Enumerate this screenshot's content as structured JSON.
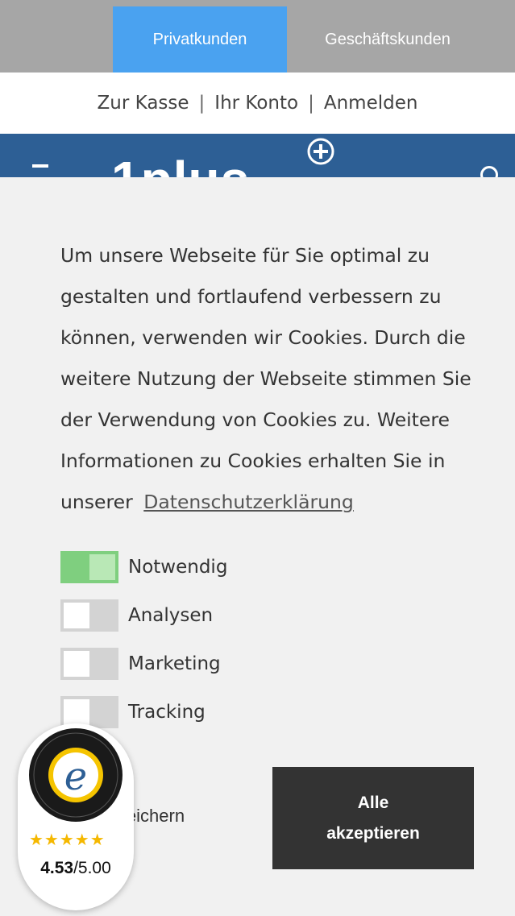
{
  "tabs": {
    "privatkunden": "Privatkunden",
    "geschaeftskunden": "Geschäftskunden"
  },
  "links": {
    "kasse": "Zur Kasse",
    "konto": "Ihr Konto",
    "anmelden": "Anmelden",
    "separator": "|"
  },
  "brand": {
    "logo": "1plus"
  },
  "cookie": {
    "text": "Um unsere Webseite für Sie optimal zu gestalten und fortlaufend verbessern zu können, verwenden wir Cookies. Durch die weitere Nutzung der Webseite stimmen Sie der Verwendung von Cookies zu. Weitere Informationen zu Cookies erhalten Sie in unserer",
    "privacy_link": "Datenschutzerklärung",
    "options": [
      {
        "label": "Notwendig",
        "enabled": true
      },
      {
        "label": "Analysen",
        "enabled": false
      },
      {
        "label": "Marketing",
        "enabled": false
      },
      {
        "label": "Tracking",
        "enabled": false
      }
    ],
    "save_label": "Speichern",
    "accept_line1": "Alle",
    "accept_line2": "akzeptieren"
  },
  "trusted_shops": {
    "stars": "★★★★★",
    "rating": "4.53",
    "rating_max": "/5.00",
    "seal_letter": "e"
  },
  "colors": {
    "tab_active": "#4aa2f0",
    "tab_bar": "#a6a6a6",
    "brand_blue": "#2d5f95",
    "toggle_on": "#7fcf7f",
    "accept_button": "#333333"
  }
}
